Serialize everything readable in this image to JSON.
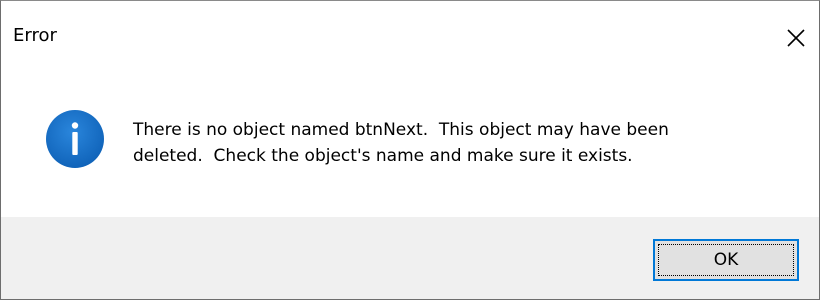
{
  "dialog": {
    "title": "Error",
    "icon": "info-icon",
    "message": "There is no object named btnNext.  This object may have been\ndeleted.  Check the object's name and make sure it exists.",
    "ok_label": "OK",
    "close_icon": "close-icon"
  },
  "colors": {
    "info_icon_fill": "#1872c8",
    "button_border": "#0078d7",
    "footer_background": "#f0f0f0",
    "button_background": "#e1e1e1"
  }
}
